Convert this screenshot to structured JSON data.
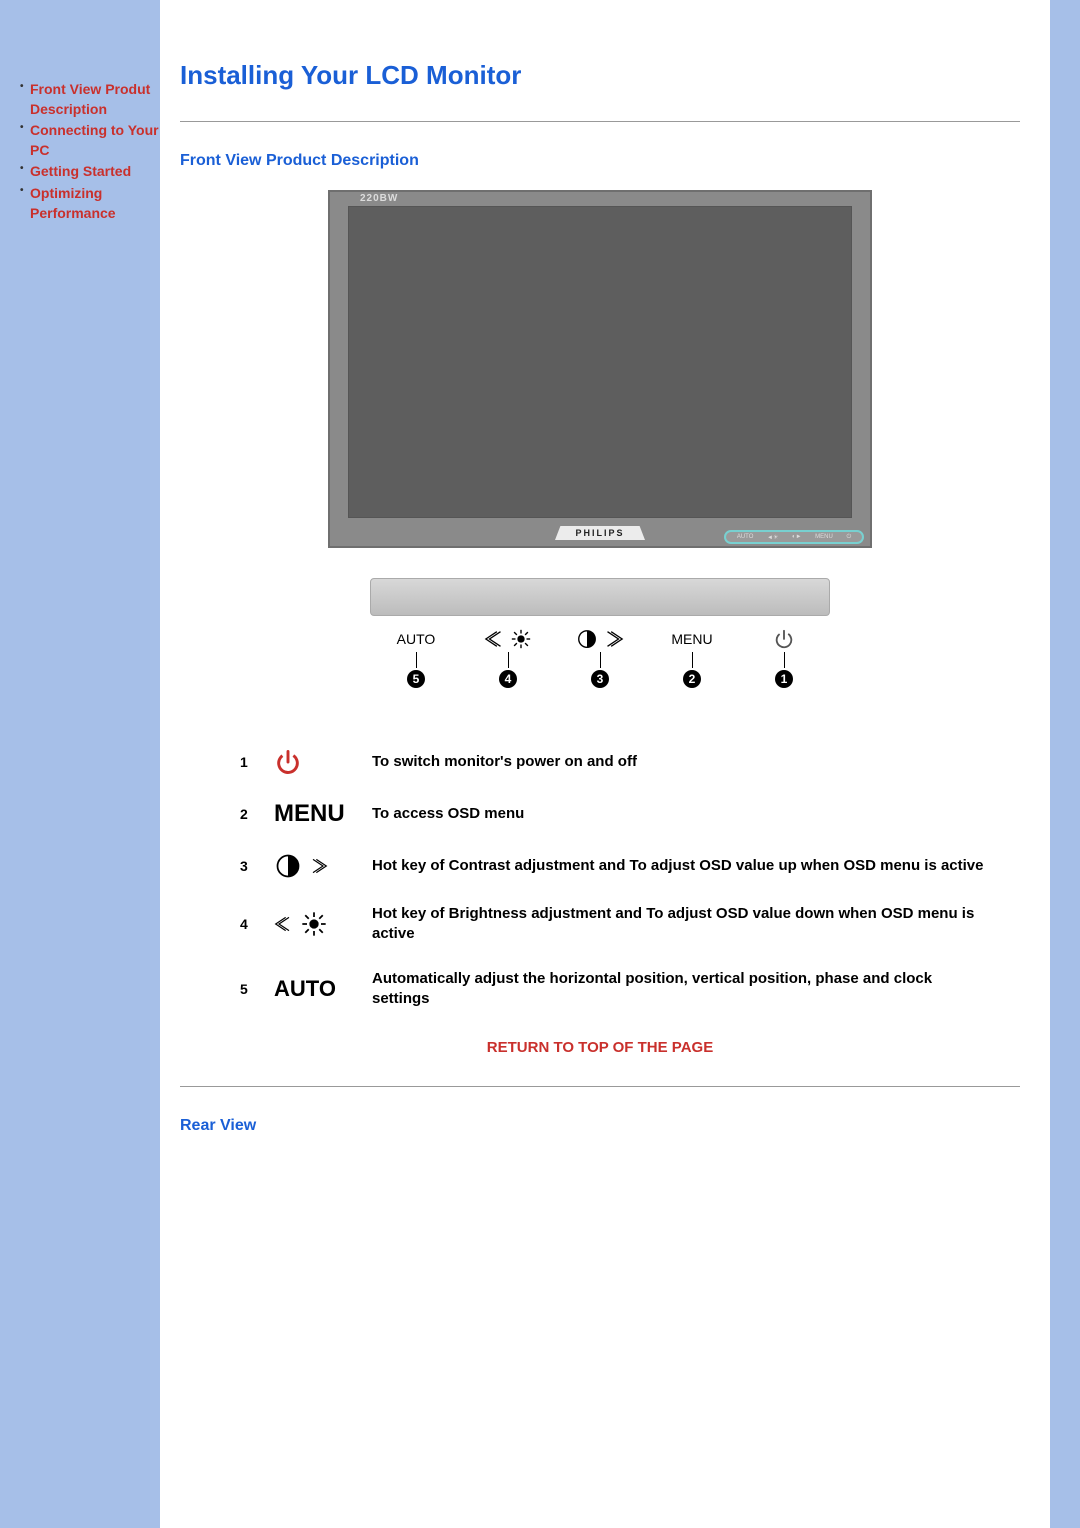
{
  "sidebar": {
    "items": [
      {
        "label": "Front View Produt Description"
      },
      {
        "label": "Connecting to Your PC"
      },
      {
        "label": "Getting Started"
      },
      {
        "label": "Optimizing Performance"
      }
    ]
  },
  "page": {
    "title": "Installing Your LCD Monitor",
    "section1": "Front View Product Description",
    "return": "RETURN TO TOP OF THE PAGE",
    "rear": "Rear View"
  },
  "monitor": {
    "model": "220BW",
    "brand": "PHILIPS",
    "callout_items": [
      "AUTO",
      "◄☀",
      "◐►",
      "MENU",
      "⏻"
    ]
  },
  "bar": {
    "items": [
      {
        "label": "AUTO",
        "num": "5"
      },
      {
        "label": "brightness",
        "num": "4"
      },
      {
        "label": "contrast",
        "num": "3"
      },
      {
        "label": "MENU",
        "num": "2"
      },
      {
        "label": "power",
        "num": "1"
      }
    ]
  },
  "legend": [
    {
      "n": "1",
      "icon": "power",
      "desc": "To switch monitor's power on and off"
    },
    {
      "n": "2",
      "icon": "MENU",
      "desc": "To access OSD menu"
    },
    {
      "n": "3",
      "icon": "contrast",
      "desc": "Hot key of Contrast adjustment and To adjust OSD value up when OSD menu is active"
    },
    {
      "n": "4",
      "icon": "brightness",
      "desc": "Hot key of Brightness adjustment and To adjust OSD value down when OSD menu is active"
    },
    {
      "n": "5",
      "icon": "AUTO",
      "desc": "Automatically adjust the horizontal position, vertical position, phase and clock settings"
    }
  ]
}
